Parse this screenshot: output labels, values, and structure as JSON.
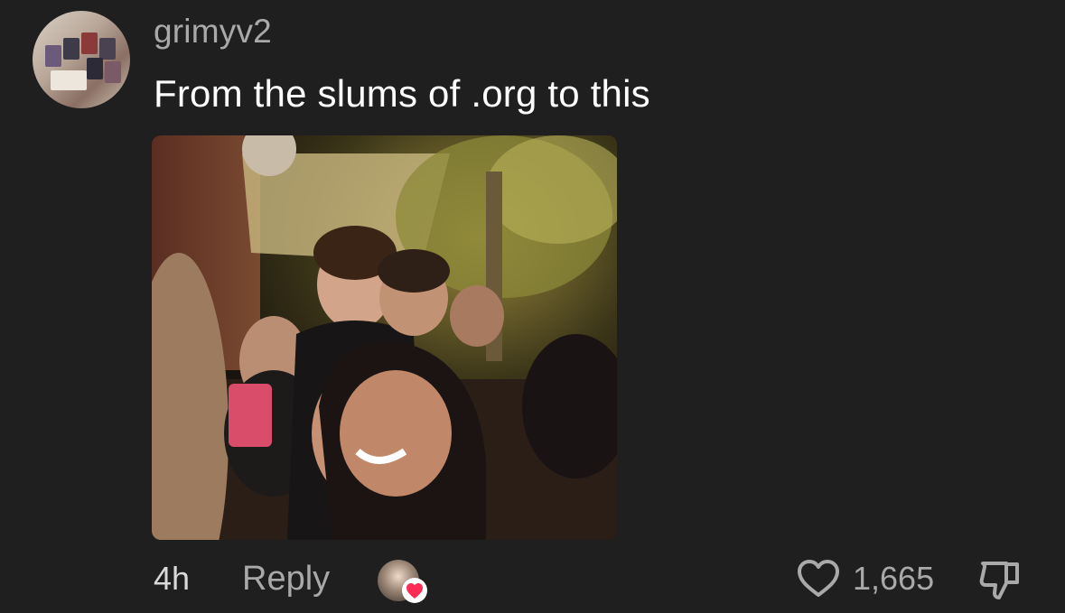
{
  "comment": {
    "username": "grimyv2",
    "text": "From the slums of .org to this",
    "timestamp": "4h",
    "reply_label": "Reply",
    "like_count": "1,665"
  },
  "icons": {
    "like": "heart-outline-icon",
    "dislike": "thumbs-down-icon",
    "creator_reaction": "heart-filled-icon"
  },
  "colors": {
    "background": "#1f1f1f",
    "username": "#a9a9a9",
    "text": "#ffffff",
    "heart_red": "#fe2c55"
  }
}
